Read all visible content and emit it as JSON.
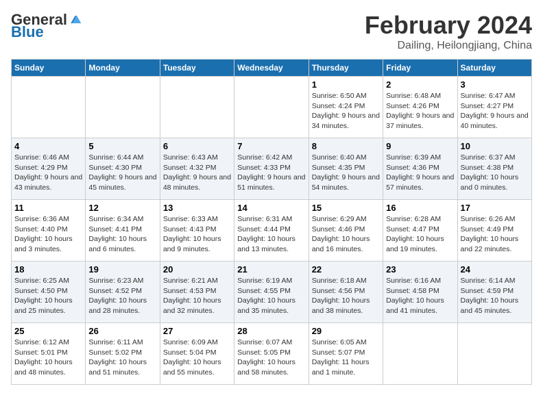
{
  "logo": {
    "general": "General",
    "blue": "Blue"
  },
  "title": {
    "month": "February 2024",
    "location": "Dailing, Heilongjiang, China"
  },
  "days_of_week": [
    "Sunday",
    "Monday",
    "Tuesday",
    "Wednesday",
    "Thursday",
    "Friday",
    "Saturday"
  ],
  "weeks": [
    [
      {
        "day": "",
        "info": ""
      },
      {
        "day": "",
        "info": ""
      },
      {
        "day": "",
        "info": ""
      },
      {
        "day": "",
        "info": ""
      },
      {
        "day": "1",
        "info": "Sunrise: 6:50 AM\nSunset: 4:24 PM\nDaylight: 9 hours and 34 minutes."
      },
      {
        "day": "2",
        "info": "Sunrise: 6:48 AM\nSunset: 4:26 PM\nDaylight: 9 hours and 37 minutes."
      },
      {
        "day": "3",
        "info": "Sunrise: 6:47 AM\nSunset: 4:27 PM\nDaylight: 9 hours and 40 minutes."
      }
    ],
    [
      {
        "day": "4",
        "info": "Sunrise: 6:46 AM\nSunset: 4:29 PM\nDaylight: 9 hours and 43 minutes."
      },
      {
        "day": "5",
        "info": "Sunrise: 6:44 AM\nSunset: 4:30 PM\nDaylight: 9 hours and 45 minutes."
      },
      {
        "day": "6",
        "info": "Sunrise: 6:43 AM\nSunset: 4:32 PM\nDaylight: 9 hours and 48 minutes."
      },
      {
        "day": "7",
        "info": "Sunrise: 6:42 AM\nSunset: 4:33 PM\nDaylight: 9 hours and 51 minutes."
      },
      {
        "day": "8",
        "info": "Sunrise: 6:40 AM\nSunset: 4:35 PM\nDaylight: 9 hours and 54 minutes."
      },
      {
        "day": "9",
        "info": "Sunrise: 6:39 AM\nSunset: 4:36 PM\nDaylight: 9 hours and 57 minutes."
      },
      {
        "day": "10",
        "info": "Sunrise: 6:37 AM\nSunset: 4:38 PM\nDaylight: 10 hours and 0 minutes."
      }
    ],
    [
      {
        "day": "11",
        "info": "Sunrise: 6:36 AM\nSunset: 4:40 PM\nDaylight: 10 hours and 3 minutes."
      },
      {
        "day": "12",
        "info": "Sunrise: 6:34 AM\nSunset: 4:41 PM\nDaylight: 10 hours and 6 minutes."
      },
      {
        "day": "13",
        "info": "Sunrise: 6:33 AM\nSunset: 4:43 PM\nDaylight: 10 hours and 9 minutes."
      },
      {
        "day": "14",
        "info": "Sunrise: 6:31 AM\nSunset: 4:44 PM\nDaylight: 10 hours and 13 minutes."
      },
      {
        "day": "15",
        "info": "Sunrise: 6:29 AM\nSunset: 4:46 PM\nDaylight: 10 hours and 16 minutes."
      },
      {
        "day": "16",
        "info": "Sunrise: 6:28 AM\nSunset: 4:47 PM\nDaylight: 10 hours and 19 minutes."
      },
      {
        "day": "17",
        "info": "Sunrise: 6:26 AM\nSunset: 4:49 PM\nDaylight: 10 hours and 22 minutes."
      }
    ],
    [
      {
        "day": "18",
        "info": "Sunrise: 6:25 AM\nSunset: 4:50 PM\nDaylight: 10 hours and 25 minutes."
      },
      {
        "day": "19",
        "info": "Sunrise: 6:23 AM\nSunset: 4:52 PM\nDaylight: 10 hours and 28 minutes."
      },
      {
        "day": "20",
        "info": "Sunrise: 6:21 AM\nSunset: 4:53 PM\nDaylight: 10 hours and 32 minutes."
      },
      {
        "day": "21",
        "info": "Sunrise: 6:19 AM\nSunset: 4:55 PM\nDaylight: 10 hours and 35 minutes."
      },
      {
        "day": "22",
        "info": "Sunrise: 6:18 AM\nSunset: 4:56 PM\nDaylight: 10 hours and 38 minutes."
      },
      {
        "day": "23",
        "info": "Sunrise: 6:16 AM\nSunset: 4:58 PM\nDaylight: 10 hours and 41 minutes."
      },
      {
        "day": "24",
        "info": "Sunrise: 6:14 AM\nSunset: 4:59 PM\nDaylight: 10 hours and 45 minutes."
      }
    ],
    [
      {
        "day": "25",
        "info": "Sunrise: 6:12 AM\nSunset: 5:01 PM\nDaylight: 10 hours and 48 minutes."
      },
      {
        "day": "26",
        "info": "Sunrise: 6:11 AM\nSunset: 5:02 PM\nDaylight: 10 hours and 51 minutes."
      },
      {
        "day": "27",
        "info": "Sunrise: 6:09 AM\nSunset: 5:04 PM\nDaylight: 10 hours and 55 minutes."
      },
      {
        "day": "28",
        "info": "Sunrise: 6:07 AM\nSunset: 5:05 PM\nDaylight: 10 hours and 58 minutes."
      },
      {
        "day": "29",
        "info": "Sunrise: 6:05 AM\nSunset: 5:07 PM\nDaylight: 11 hours and 1 minute."
      },
      {
        "day": "",
        "info": ""
      },
      {
        "day": "",
        "info": ""
      }
    ]
  ]
}
